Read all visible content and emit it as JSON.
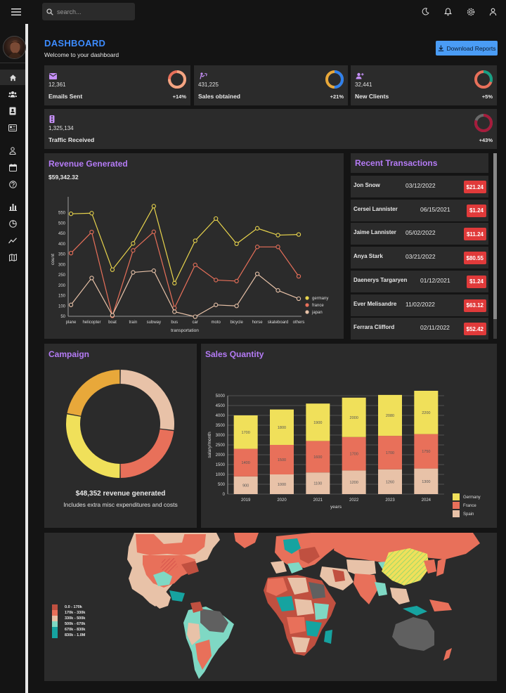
{
  "search": {
    "placeholder": "search..."
  },
  "header": {
    "title": "DASHBOARD",
    "subtitle": "Welcome to your dashboard",
    "download_label": "Download Reports"
  },
  "colors": {
    "accent": "#3d8cff",
    "purple": "#b57bf6",
    "card": "#2b2b2b",
    "badge": "#e03a3a"
  },
  "stats": [
    {
      "icon": "email-icon",
      "value": "12,361",
      "label": "Emails Sent",
      "pct": "+14%",
      "ring_fill": 0.75,
      "ring_color": "#f4a582"
    },
    {
      "icon": "point-of-sale-icon",
      "value": "431,225",
      "label": "Sales obtained",
      "pct": "+21%",
      "ring_fill": 0.5,
      "ring_color": "#2f80ed"
    },
    {
      "icon": "person-add-icon",
      "value": "32,441",
      "label": "New Clients",
      "pct": "+5%",
      "ring_fill": 0.3,
      "ring_color": "#16a085"
    },
    {
      "icon": "traffic-icon",
      "value": "1,325,134",
      "label": "Traffic Received",
      "pct": "+43%",
      "ring_fill": 0.8,
      "ring_color": "#a61c3c"
    }
  ],
  "revenue": {
    "title": "Revenue Generated",
    "amount": "$59,342.32"
  },
  "transactions": {
    "title": "Recent Transactions",
    "rows": [
      {
        "name": "Jon Snow",
        "date": "03/12/2022",
        "amount": "$21.24"
      },
      {
        "name": "Cersei Lannister",
        "date": "06/15/2021",
        "amount": "$1.24"
      },
      {
        "name": "Jaime Lannister",
        "date": "05/02/2022",
        "amount": "$11.24"
      },
      {
        "name": "Anya Stark",
        "date": "03/21/2022",
        "amount": "$80.55"
      },
      {
        "name": "Daenerys Targaryen",
        "date": "01/12/2021",
        "amount": "$1.24"
      },
      {
        "name": "Ever Melisandre",
        "date": "11/02/2022",
        "amount": "$63.12"
      },
      {
        "name": "Ferrara Clifford",
        "date": "02/11/2022",
        "amount": "$52.42"
      }
    ]
  },
  "campaign": {
    "title": "Campaign",
    "revenue_text": "$48,352 revenue generated",
    "sub_text": "Includes extra misc expenditures and costs"
  },
  "sales": {
    "title": "Sales Quantity"
  },
  "map_legend": [
    "0.0 - 170k",
    "170k - 330k",
    "330k - 500k",
    "500k - 670k",
    "670k - 830k",
    "830k - 1.0M"
  ],
  "chart_data": [
    {
      "type": "line",
      "categories": [
        "plane",
        "helicopter",
        "boat",
        "train",
        "subway",
        "bus",
        "car",
        "moto",
        "bicycle",
        "horse",
        "skateboard",
        "others"
      ],
      "xlabel": "transportation",
      "ylabel": "count",
      "ylim": [
        50,
        600
      ],
      "yticks": [
        50,
        100,
        150,
        200,
        250,
        300,
        350,
        400,
        450,
        500,
        550
      ],
      "legend": "bottom-right",
      "series": [
        {
          "name": "germany",
          "color": "#e8d44d",
          "values": [
            545,
            548,
            275,
            402,
            582,
            210,
            415,
            522,
            400,
            475,
            442,
            445
          ]
        },
        {
          "name": "france",
          "color": "#e8705a",
          "values": [
            355,
            457,
            52,
            368,
            458,
            90,
            298,
            225,
            220,
            385,
            385,
            243
          ]
        },
        {
          "name": "japan",
          "color": "#e8c2a8",
          "values": [
            105,
            235,
            55,
            262,
            270,
            72,
            48,
            105,
            100,
            255,
            175,
            135
          ]
        }
      ]
    },
    {
      "type": "pie",
      "donut": true,
      "slices": [
        {
          "color": "#e8c2a8",
          "value": 27
        },
        {
          "color": "#e8705a",
          "value": 23
        },
        {
          "color": "#f0e05a",
          "value": 28
        },
        {
          "color": "#e8a83a",
          "value": 22
        }
      ]
    },
    {
      "type": "bar",
      "stacked": true,
      "categories": [
        "2019",
        "2020",
        "2021",
        "2022",
        "2023",
        "2024"
      ],
      "xlabel": "years",
      "ylabel": "salary/month",
      "ylim": [
        0,
        5000
      ],
      "yticks": [
        0,
        500,
        1000,
        1500,
        2000,
        2500,
        3000,
        3500,
        4000,
        4500,
        5000
      ],
      "legend": "right",
      "series": [
        {
          "name": "Spain",
          "color": "#e8c2a8",
          "values": [
            900,
            1000,
            1100,
            1200,
            1260,
            1300
          ]
        },
        {
          "name": "France",
          "color": "#e8705a",
          "values": [
            1400,
            1500,
            1600,
            1700,
            1700,
            1750
          ]
        },
        {
          "name": "Germany",
          "color": "#f0e05a",
          "values": [
            1700,
            1800,
            1900,
            2000,
            2080,
            2200
          ]
        }
      ]
    }
  ]
}
